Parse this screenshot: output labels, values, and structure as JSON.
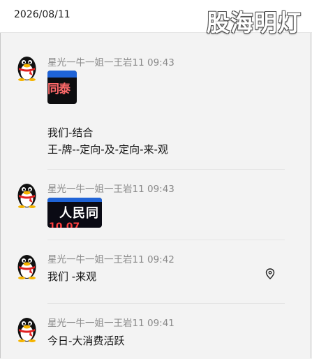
{
  "header": {
    "date": "2026/08/11"
  },
  "watermark": "股海明灯",
  "messages": [
    {
      "sender": "星光一牛一姐一王岩11",
      "time": "09:43",
      "image_text": "同泰",
      "lines": [
        "我们-结合",
        "王-牌--定向-及-定向-来-观"
      ]
    },
    {
      "sender": "星光一牛一姐一王岩11",
      "time": "09:43",
      "image_text": "人民同",
      "image_subtext": "10.07"
    },
    {
      "sender": "星光一牛一姐一王岩11",
      "time": "09:42",
      "lines": [
        "我们 -来观"
      ]
    },
    {
      "sender": "星光一牛一姐一王岩11",
      "time": "09:41",
      "lines": [
        "今日-大消费活跃"
      ]
    }
  ],
  "colors": {
    "accent_blue": "#1f63d6",
    "meta_gray": "#8a8a8a"
  },
  "icons": {
    "avatar": "penguin-avatar-icon",
    "pin": "location-pin-icon"
  }
}
